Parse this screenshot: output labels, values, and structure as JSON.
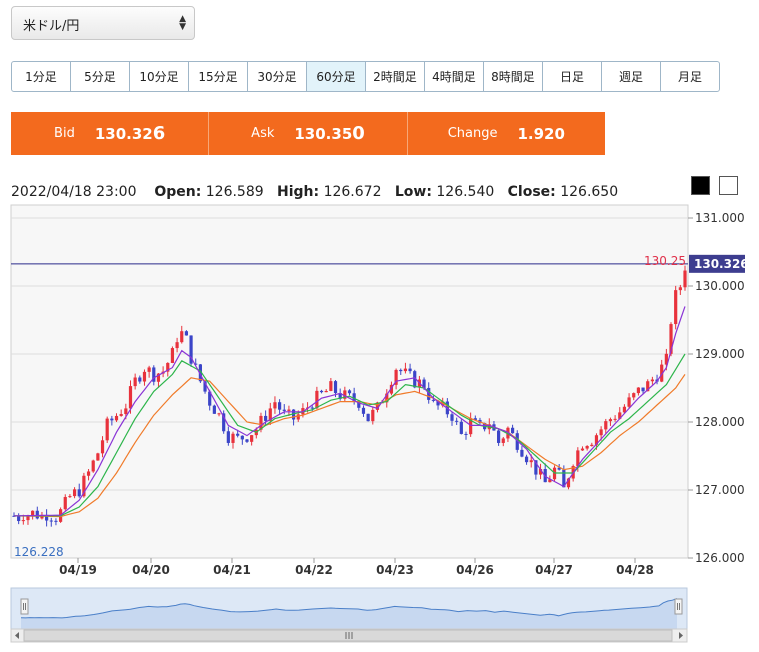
{
  "pair_select": {
    "value": "米ドル/円"
  },
  "timeframes": [
    {
      "label": "1分足",
      "active": false
    },
    {
      "label": "5分足",
      "active": false
    },
    {
      "label": "10分足",
      "active": false
    },
    {
      "label": "15分足",
      "active": false
    },
    {
      "label": "30分足",
      "active": false
    },
    {
      "label": "60分足",
      "active": true
    },
    {
      "label": "2時間足",
      "active": false
    },
    {
      "label": "4時間足",
      "active": false
    },
    {
      "label": "8時間足",
      "active": false
    },
    {
      "label": "日足",
      "active": false
    },
    {
      "label": "週足",
      "active": false
    },
    {
      "label": "月足",
      "active": false
    }
  ],
  "quotes": {
    "bid_label": "Bid",
    "bid_main": "130.32",
    "bid_pip": "6",
    "ask_label": "Ask",
    "ask_main": "130.35",
    "ask_pip": "0",
    "change_label": "Change",
    "change_value": "1.920"
  },
  "ohlc": {
    "datetime": "2022/04/18 23:00",
    "open_label": "Open:",
    "open": "126.589",
    "high_label": "High:",
    "high": "126.672",
    "low_label": "Low:",
    "low": "126.540",
    "close_label": "Close:",
    "close": "126.650"
  },
  "colors": {
    "accent": "#f36a1e",
    "up": "#e8323c",
    "down": "#3b45c8",
    "ma_short": "#8a34d6",
    "ma_mid": "#2db54b",
    "ma_long": "#f07b2a",
    "navigator": "#4a7fc8"
  },
  "chart_data": {
    "type": "candlestick",
    "y_ticks": [
      "131.000",
      "130.000",
      "129.000",
      "128.000",
      "127.000",
      "126.000"
    ],
    "ylim": [
      126.0,
      131.0
    ],
    "x_ticks": [
      "04/19",
      "04/20",
      "04/21",
      "04/22",
      "04/23",
      "04/26",
      "04/27",
      "04/28"
    ],
    "current_price_label": "130.326",
    "high_marker_label": "130.25",
    "low_marker_label": "126.228",
    "close_path": [
      [
        0,
        126.62
      ],
      [
        1,
        126.6
      ],
      [
        2,
        126.65
      ],
      [
        3,
        126.63
      ],
      [
        4,
        126.66
      ],
      [
        5,
        126.64
      ],
      [
        6,
        126.62
      ],
      [
        7,
        126.65
      ],
      [
        8,
        126.63
      ],
      [
        9,
        126.6
      ],
      [
        10,
        126.68
      ],
      [
        12,
        126.9
      ],
      [
        14,
        127.0
      ],
      [
        16,
        127.25
      ],
      [
        18,
        127.55
      ],
      [
        20,
        127.95
      ],
      [
        22,
        128.1
      ],
      [
        24,
        128.25
      ],
      [
        26,
        128.6
      ],
      [
        28,
        128.8
      ],
      [
        30,
        128.7
      ],
      [
        32,
        128.75
      ],
      [
        34,
        129.0
      ],
      [
        35,
        129.25
      ],
      [
        36,
        129.3
      ],
      [
        37,
        129.2
      ],
      [
        38,
        128.95
      ],
      [
        40,
        128.6
      ],
      [
        42,
        128.3
      ],
      [
        44,
        128.1
      ],
      [
        46,
        127.8
      ],
      [
        48,
        127.75
      ],
      [
        50,
        127.8
      ],
      [
        52,
        127.9
      ],
      [
        54,
        128.1
      ],
      [
        56,
        128.3
      ],
      [
        58,
        128.1
      ],
      [
        60,
        128.05
      ],
      [
        62,
        128.15
      ],
      [
        64,
        128.3
      ],
      [
        66,
        128.4
      ],
      [
        68,
        128.5
      ],
      [
        70,
        128.4
      ],
      [
        72,
        128.35
      ],
      [
        74,
        128.3
      ],
      [
        76,
        128.05
      ],
      [
        78,
        128.2
      ],
      [
        80,
        128.5
      ],
      [
        82,
        128.8
      ],
      [
        84,
        128.7
      ],
      [
        86,
        128.6
      ],
      [
        88,
        128.55
      ],
      [
        90,
        128.25
      ],
      [
        92,
        128.2
      ],
      [
        94,
        128.1
      ],
      [
        96,
        127.8
      ],
      [
        98,
        128.0
      ],
      [
        100,
        127.9
      ],
      [
        102,
        128.0
      ],
      [
        104,
        127.7
      ],
      [
        106,
        127.9
      ],
      [
        108,
        127.7
      ],
      [
        110,
        127.5
      ],
      [
        112,
        127.3
      ],
      [
        114,
        127.1
      ],
      [
        116,
        127.3
      ],
      [
        117,
        127.2
      ],
      [
        118,
        127.0
      ],
      [
        120,
        127.45
      ],
      [
        122,
        127.7
      ],
      [
        124,
        127.75
      ],
      [
        126,
        127.9
      ],
      [
        128,
        128.05
      ],
      [
        130,
        128.15
      ],
      [
        132,
        128.3
      ],
      [
        134,
        128.45
      ],
      [
        136,
        128.55
      ],
      [
        138,
        128.7
      ],
      [
        140,
        128.9
      ],
      [
        141,
        129.5
      ],
      [
        142,
        129.85
      ],
      [
        143,
        130.0
      ],
      [
        144,
        130.3
      ]
    ],
    "ma_short": [
      [
        0,
        126.62
      ],
      [
        10,
        126.63
      ],
      [
        14,
        126.85
      ],
      [
        18,
        127.3
      ],
      [
        22,
        127.85
      ],
      [
        26,
        128.3
      ],
      [
        30,
        128.65
      ],
      [
        34,
        128.8
      ],
      [
        36,
        129.05
      ],
      [
        38,
        128.95
      ],
      [
        42,
        128.45
      ],
      [
        46,
        127.95
      ],
      [
        50,
        127.8
      ],
      [
        54,
        128.0
      ],
      [
        58,
        128.15
      ],
      [
        62,
        128.15
      ],
      [
        66,
        128.35
      ],
      [
        70,
        128.42
      ],
      [
        74,
        128.28
      ],
      [
        78,
        128.2
      ],
      [
        82,
        128.6
      ],
      [
        86,
        128.65
      ],
      [
        90,
        128.35
      ],
      [
        94,
        128.15
      ],
      [
        98,
        127.95
      ],
      [
        102,
        127.95
      ],
      [
        106,
        127.85
      ],
      [
        110,
        127.6
      ],
      [
        114,
        127.2
      ],
      [
        118,
        127.05
      ],
      [
        122,
        127.45
      ],
      [
        126,
        127.75
      ],
      [
        130,
        128.05
      ],
      [
        134,
        128.35
      ],
      [
        138,
        128.6
      ],
      [
        140,
        128.8
      ],
      [
        142,
        129.3
      ],
      [
        144,
        129.7
      ]
    ],
    "ma_mid": [
      [
        0,
        126.62
      ],
      [
        10,
        126.62
      ],
      [
        14,
        126.75
      ],
      [
        18,
        127.05
      ],
      [
        22,
        127.55
      ],
      [
        26,
        128.05
      ],
      [
        30,
        128.45
      ],
      [
        34,
        128.7
      ],
      [
        36,
        128.9
      ],
      [
        40,
        128.75
      ],
      [
        44,
        128.35
      ],
      [
        48,
        127.95
      ],
      [
        52,
        127.85
      ],
      [
        56,
        128.05
      ],
      [
        60,
        128.12
      ],
      [
        64,
        128.18
      ],
      [
        68,
        128.32
      ],
      [
        72,
        128.38
      ],
      [
        76,
        128.25
      ],
      [
        80,
        128.3
      ],
      [
        84,
        128.55
      ],
      [
        88,
        128.5
      ],
      [
        92,
        128.3
      ],
      [
        96,
        128.1
      ],
      [
        100,
        127.95
      ],
      [
        104,
        127.9
      ],
      [
        108,
        127.75
      ],
      [
        112,
        127.5
      ],
      [
        116,
        127.25
      ],
      [
        120,
        127.25
      ],
      [
        124,
        127.55
      ],
      [
        128,
        127.85
      ],
      [
        132,
        128.05
      ],
      [
        136,
        128.3
      ],
      [
        140,
        128.55
      ],
      [
        144,
        129.0
      ]
    ],
    "ma_long": [
      [
        0,
        126.62
      ],
      [
        10,
        126.61
      ],
      [
        14,
        126.68
      ],
      [
        18,
        126.88
      ],
      [
        22,
        127.25
      ],
      [
        26,
        127.7
      ],
      [
        30,
        128.1
      ],
      [
        34,
        128.4
      ],
      [
        38,
        128.65
      ],
      [
        42,
        128.6
      ],
      [
        46,
        128.3
      ],
      [
        50,
        128.0
      ],
      [
        54,
        127.95
      ],
      [
        58,
        128.05
      ],
      [
        62,
        128.1
      ],
      [
        66,
        128.2
      ],
      [
        70,
        128.3
      ],
      [
        74,
        128.3
      ],
      [
        78,
        128.25
      ],
      [
        82,
        128.4
      ],
      [
        86,
        128.45
      ],
      [
        90,
        128.35
      ],
      [
        94,
        128.2
      ],
      [
        98,
        128.05
      ],
      [
        102,
        127.95
      ],
      [
        106,
        127.85
      ],
      [
        110,
        127.65
      ],
      [
        114,
        127.45
      ],
      [
        118,
        127.3
      ],
      [
        122,
        127.35
      ],
      [
        126,
        127.55
      ],
      [
        130,
        127.8
      ],
      [
        134,
        128.0
      ],
      [
        138,
        128.25
      ],
      [
        142,
        128.5
      ],
      [
        144,
        128.7
      ]
    ]
  }
}
